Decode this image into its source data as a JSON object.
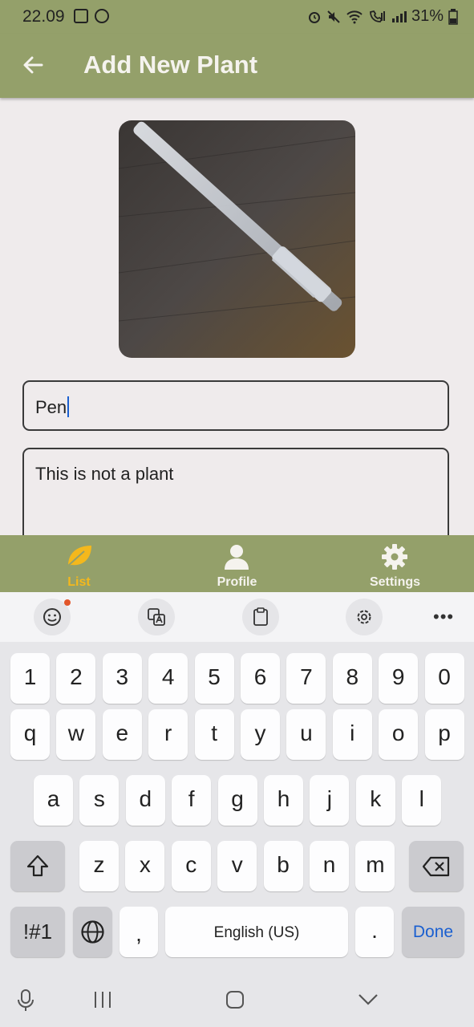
{
  "status_bar": {
    "time": "22.09",
    "battery": "31%"
  },
  "app_bar": {
    "title": "Add New Plant"
  },
  "form": {
    "name_value": "Pen",
    "description_value": "This is not a plant"
  },
  "bottom_nav": [
    {
      "label": "List",
      "icon": "leaf-icon",
      "active": true
    },
    {
      "label": "Profile",
      "icon": "person-icon",
      "active": false
    },
    {
      "label": "Settings",
      "icon": "gear-icon",
      "active": false
    }
  ],
  "keyboard": {
    "toolbar": [
      "emoji-icon",
      "translate-icon",
      "clipboard-icon",
      "settings-icon",
      "more-icon"
    ],
    "row_numbers": [
      "1",
      "2",
      "3",
      "4",
      "5",
      "6",
      "7",
      "8",
      "9",
      "0"
    ],
    "row_1": [
      "q",
      "w",
      "e",
      "r",
      "t",
      "y",
      "u",
      "i",
      "o",
      "p"
    ],
    "row_2": [
      "a",
      "s",
      "d",
      "f",
      "g",
      "h",
      "j",
      "k",
      "l"
    ],
    "row_3": [
      "z",
      "x",
      "c",
      "v",
      "b",
      "n",
      "m"
    ],
    "symbols_label": "!#1",
    "comma_label": ",",
    "space_label": "English (US)",
    "period_label": ".",
    "done_label": "Done"
  },
  "colors": {
    "app_green": "#94a06a",
    "active_tab": "#f4b81c",
    "done_blue": "#1a5fd0"
  }
}
